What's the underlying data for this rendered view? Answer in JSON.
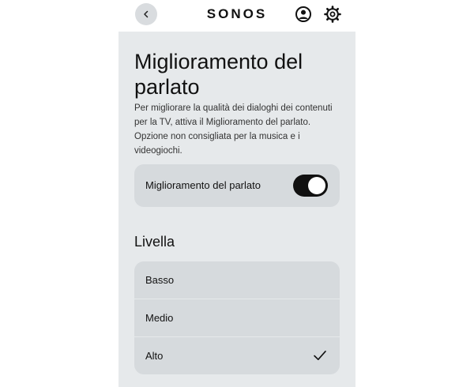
{
  "header": {
    "brand": "SONOS",
    "back_icon": "chevron-left-icon",
    "account_icon": "account-icon",
    "settings_icon": "gear-icon"
  },
  "page": {
    "title": "Miglioramento del parlato",
    "description": "Per migliorare la qualità dei dialoghi dei contenuti per la TV, attiva il Miglioramento del parlato. Opzione non consigliata per la musica e i videogiochi."
  },
  "toggle": {
    "label": "Miglioramento del parlato",
    "on": true
  },
  "level": {
    "heading": "Livella",
    "options": [
      {
        "label": "Basso",
        "selected": false
      },
      {
        "label": "Medio",
        "selected": false
      },
      {
        "label": "Alto",
        "selected": true
      }
    ]
  },
  "colors": {
    "panel_bg": "#e6e9eb",
    "card_bg": "#d6dadd",
    "toggle_on": "#111111"
  }
}
